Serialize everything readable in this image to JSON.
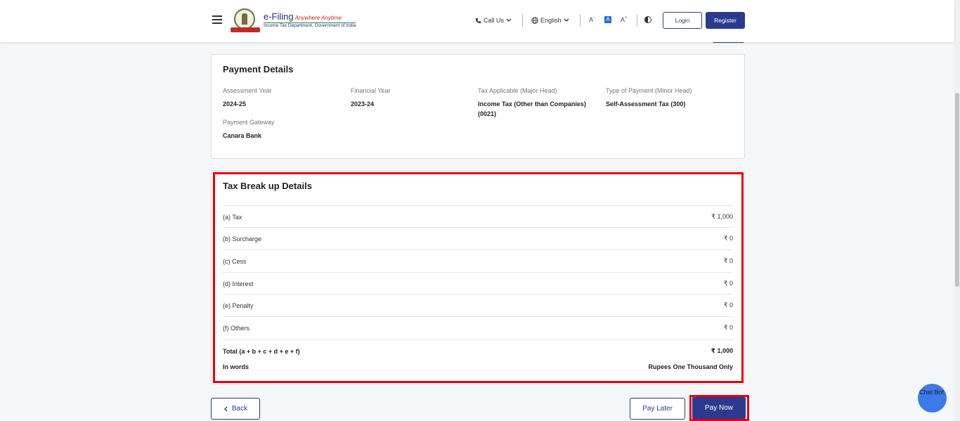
{
  "header": {
    "logo_title": "e-Filing",
    "logo_tagline": "Anywhere Anytime",
    "logo_subtitle": "Income Tax Department, Government of India",
    "call_us": "Call Us",
    "language": "English",
    "font_decrease": "A",
    "font_normal": "A",
    "font_increase": "A",
    "login": "Login",
    "register": "Register"
  },
  "payment_details": {
    "title": "Payment Details",
    "fields": [
      {
        "label": "Assessment Year",
        "value": "2024-25"
      },
      {
        "label": "Financial Year",
        "value": "2023-24"
      },
      {
        "label": "Tax Applicable (Major Head)",
        "value": "Income Tax (Other than Companies) (0021)"
      },
      {
        "label": "Type of Payment (Minor Head)",
        "value": "Self-Assessment Tax (300)"
      },
      {
        "label": "Payment Gateway",
        "value": "Canara Bank"
      }
    ]
  },
  "tax_breakup": {
    "title": "Tax Break up Details",
    "rows": [
      {
        "label": "(a) Tax",
        "value": "₹ 1,000"
      },
      {
        "label": "(b) Surcharge",
        "value": "₹ 0"
      },
      {
        "label": "(c) Cess",
        "value": "₹ 0"
      },
      {
        "label": "(d) Interest",
        "value": "₹ 0"
      },
      {
        "label": "(e) Penalty",
        "value": "₹ 0"
      },
      {
        "label": "(f) Others",
        "value": "₹ 0"
      }
    ],
    "total_label": "Total (a + b + c + d + e + f)",
    "total_value": "₹ 1,000",
    "words_label": "In words",
    "words_value": "Rupees One Thousand Only"
  },
  "actions": {
    "back": "Back",
    "pay_later": "Pay Later",
    "pay_now": "Pay Now"
  },
  "chatbot": {
    "alt_text": "Chat Bot"
  },
  "colors": {
    "primary": "#2b3a8f",
    "highlight": "#e3000f",
    "chatbot": "#3d7ae8"
  }
}
